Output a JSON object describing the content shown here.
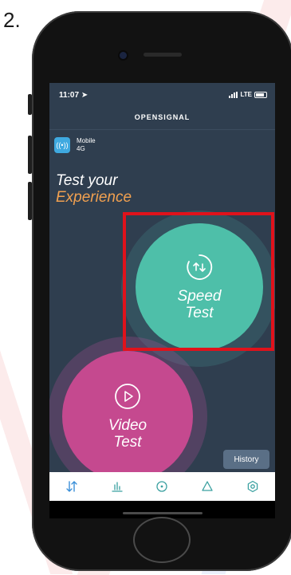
{
  "step_label": "2.",
  "status_bar": {
    "time": "11:07",
    "network_type": "LTE"
  },
  "brand": "OPENSIGNAL",
  "network": {
    "line1": "Mobile",
    "line2": "4G"
  },
  "headline": {
    "line1": "Test your",
    "line2": "Experience"
  },
  "speed_test": {
    "line1": "Speed",
    "line2": "Test",
    "icon": "upload-download-arrows-icon"
  },
  "video_test": {
    "line1": "Video",
    "line2": "Test",
    "icon": "play-icon"
  },
  "history_label": "History",
  "tabs": [
    {
      "icon": "speed-arrows-icon",
      "active": true
    },
    {
      "icon": "bar-chart-icon",
      "active": false
    },
    {
      "icon": "map-pin-icon",
      "active": false
    },
    {
      "icon": "triangle-icon",
      "active": false
    },
    {
      "icon": "settings-icon",
      "active": false
    }
  ],
  "colors": {
    "screen_bg": "#2f3e4f",
    "speed_circle": "#4ebfa9",
    "video_circle": "#c5498f",
    "accent_text": "#f0a050",
    "highlight": "#e0121b",
    "tab_active": "#3a8fd8",
    "tab_inactive": "#3aa0a0"
  }
}
